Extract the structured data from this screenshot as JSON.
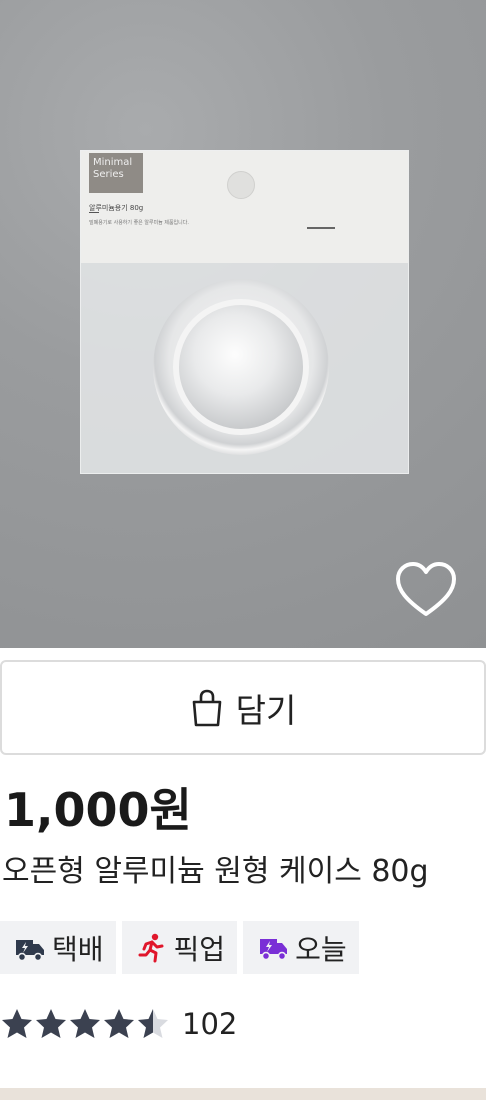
{
  "product_image": {
    "package_brand_line1": "Minimal",
    "package_brand_line2": "Series",
    "package_label": "알루미늄용기 80g",
    "package_subtext": "밀폐용기로 사용하기 좋은 알루미늄 제품입니다."
  },
  "icons": {
    "wishlist": "heart-outline-icon",
    "cart": "shopping-bag-icon",
    "delivery": "truck-icon",
    "pickup": "running-person-icon",
    "today": "fast-delivery-icon",
    "rating": "star-icon"
  },
  "cart_button": {
    "label": "담기"
  },
  "price": "1,000원",
  "product_name": "오픈형 알루미늄 원형 케이스 80g",
  "badges": [
    {
      "label": "택배",
      "color": "#2f3a4c"
    },
    {
      "label": "픽업",
      "color": "#e0162b"
    },
    {
      "label": "오늘",
      "color": "#7a2fd6"
    }
  ],
  "rating": {
    "stars": 4.5,
    "max": 5,
    "review_count": "102"
  },
  "colors": {
    "star": "#3b4150",
    "badge_bg": "#f1f2f4"
  }
}
